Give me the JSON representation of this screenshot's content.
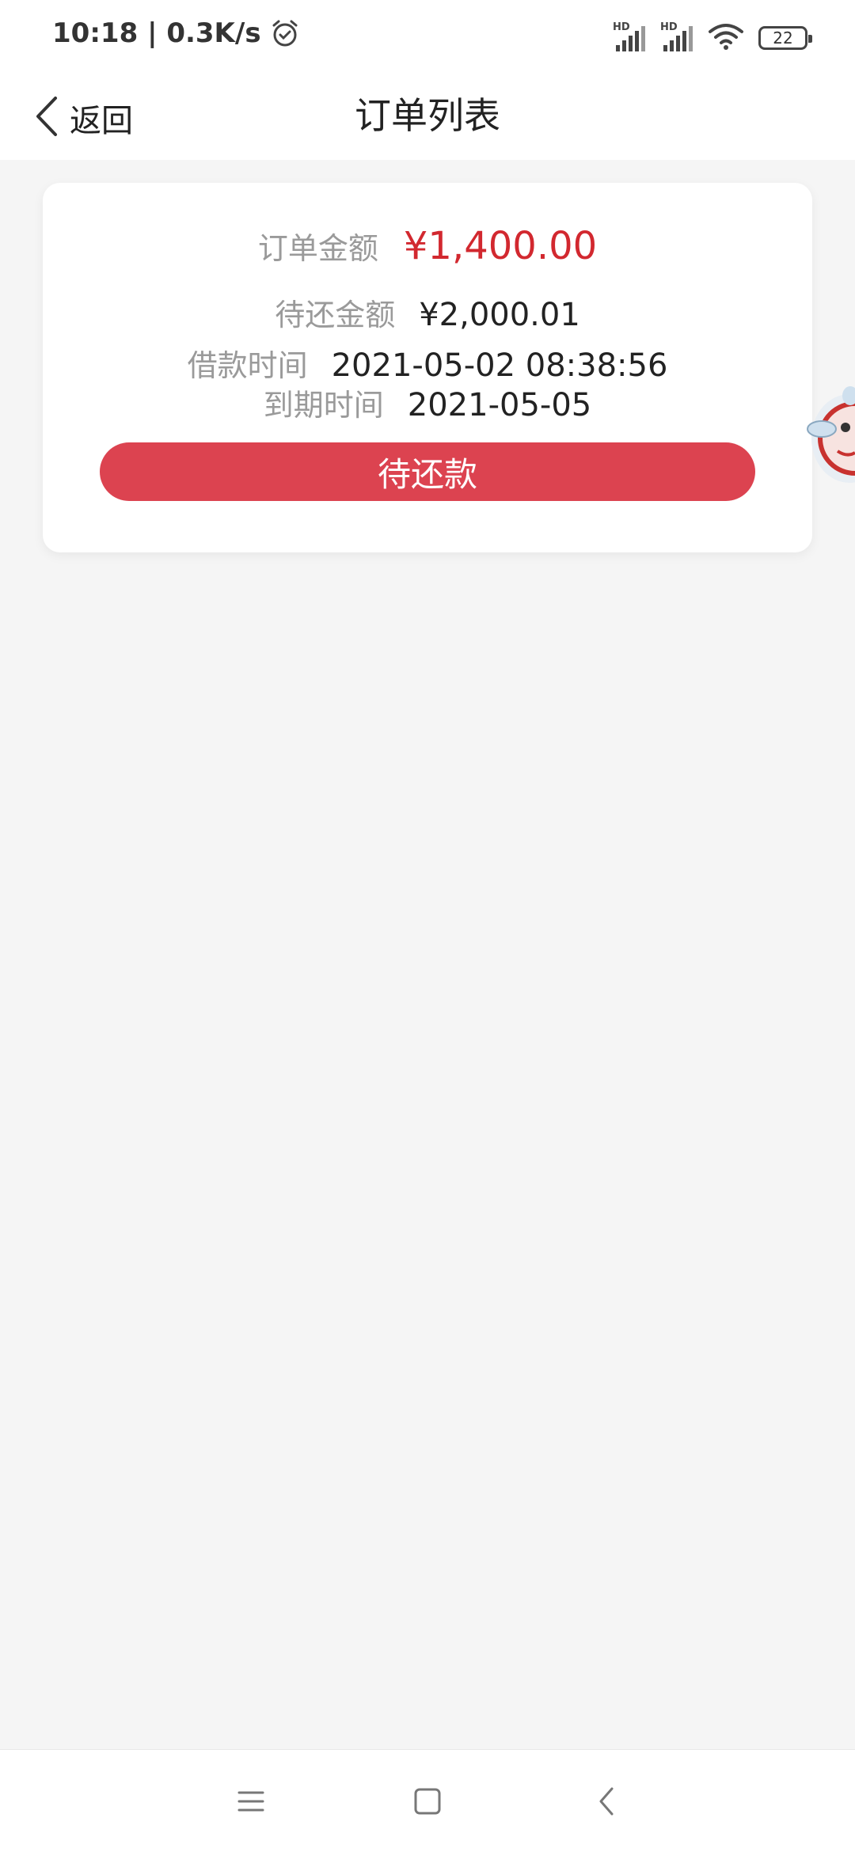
{
  "status_bar": {
    "time_speed": "10:18 | 0.3K/s",
    "signal_1_label": "HD",
    "signal_2_label": "HD",
    "battery_level": "22"
  },
  "header": {
    "back_label": "返回",
    "title": "订单列表"
  },
  "order": {
    "order_amount_label": "订单金额",
    "order_amount_value": "¥1,400.00",
    "pending_amount_label": "待还金额",
    "pending_amount_value": "¥2,000.01",
    "loan_time_label": "借款时间",
    "loan_time_value": "2021-05-02 08:38:56",
    "due_time_label": "到期时间",
    "due_time_value": "2021-05-05",
    "repay_button_label": "待还款"
  },
  "colors": {
    "accent_red": "#dc4350",
    "amount_red": "#d2282f",
    "background": "#f5f5f5"
  },
  "icons": {
    "back": "chevron-left-icon",
    "alarm": "alarm-clock-icon",
    "wifi": "wifi-icon",
    "battery": "battery-icon",
    "nav_menu": "menu-icon",
    "nav_home": "square-home-icon",
    "nav_back": "chevron-back-icon"
  }
}
